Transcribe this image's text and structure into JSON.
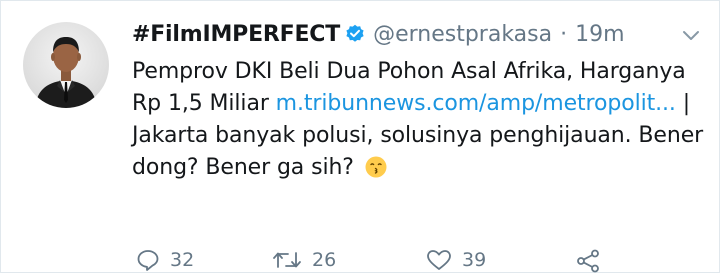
{
  "tweet": {
    "display_name": "#FilmIMPERFECT",
    "handle": "@ernestprakasa",
    "separator": "·",
    "time": "19m",
    "text_part1": "Pemprov DKI Beli Dua Pohon Asal Afrika, Harganya Rp 1,5 Miliar ",
    "link_text": "m.tribunnews.com/amp/metropolit...",
    "text_part2": " | Jakarta banyak polusi, solusinya penghijauan. Bener dong? Bener ga sih?",
    "emoji": "kissing-face"
  },
  "actions": {
    "reply_count": "32",
    "retweet_count": "26",
    "like_count": "39"
  },
  "colors": {
    "link": "#1b95e0",
    "verified": "#1da1f2",
    "muted": "#657786",
    "text": "#14171a"
  }
}
